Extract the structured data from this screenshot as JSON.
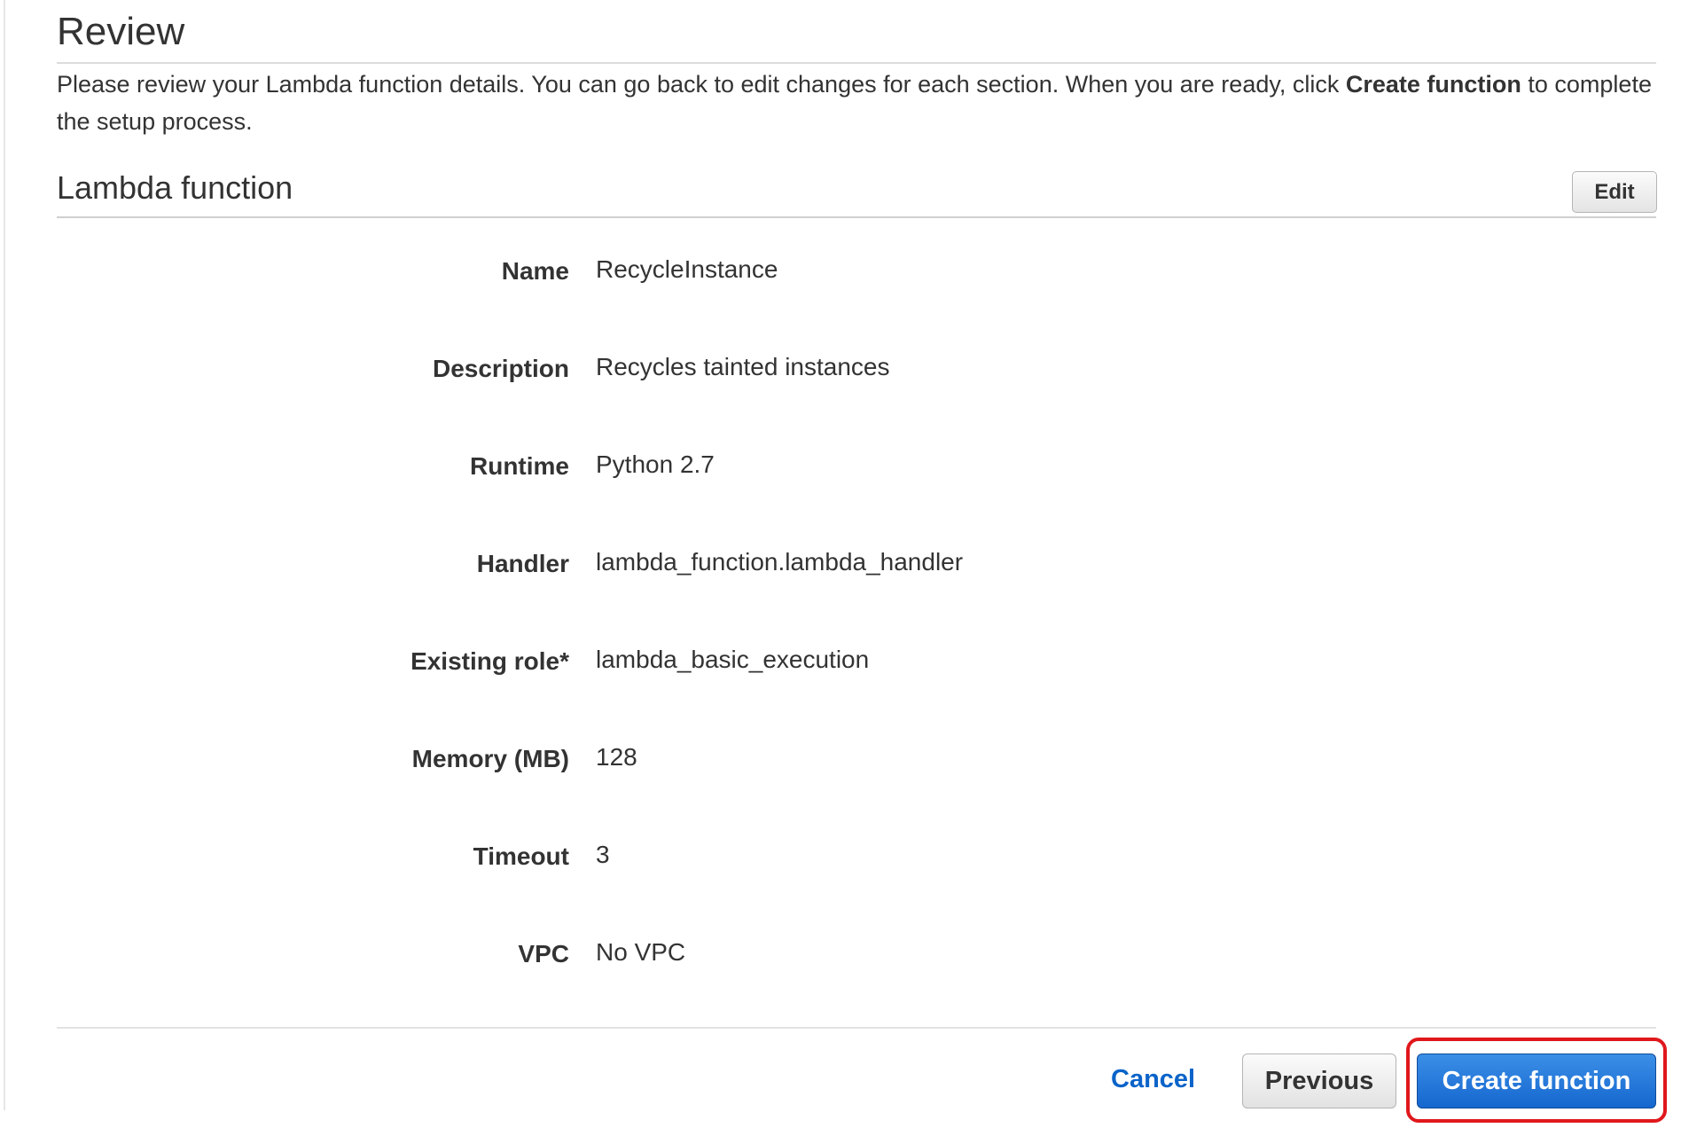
{
  "review": {
    "title": "Review",
    "intro_before": "Please review your Lambda function details. You can go back to edit changes for each section. When you are ready, click ",
    "intro_bold": "Create function",
    "intro_after": " to complete the setup process."
  },
  "section": {
    "title": "Lambda function",
    "edit_label": "Edit"
  },
  "details": [
    {
      "label": "Name",
      "value": "RecycleInstance"
    },
    {
      "label": "Description",
      "value": "Recycles tainted instances"
    },
    {
      "label": "Runtime",
      "value": "Python 2.7"
    },
    {
      "label": "Handler",
      "value": "lambda_function.lambda_handler"
    },
    {
      "label": "Existing role*",
      "value": "lambda_basic_execution"
    },
    {
      "label": "Memory (MB)",
      "value": "128"
    },
    {
      "label": "Timeout",
      "value": "3"
    },
    {
      "label": "VPC",
      "value": "No VPC"
    }
  ],
  "footer": {
    "cancel_label": "Cancel",
    "previous_label": "Previous",
    "create_label": "Create function"
  },
  "colors": {
    "primary_button": "#1567cf",
    "link": "#0a63c9",
    "highlight": "#e0181c"
  }
}
